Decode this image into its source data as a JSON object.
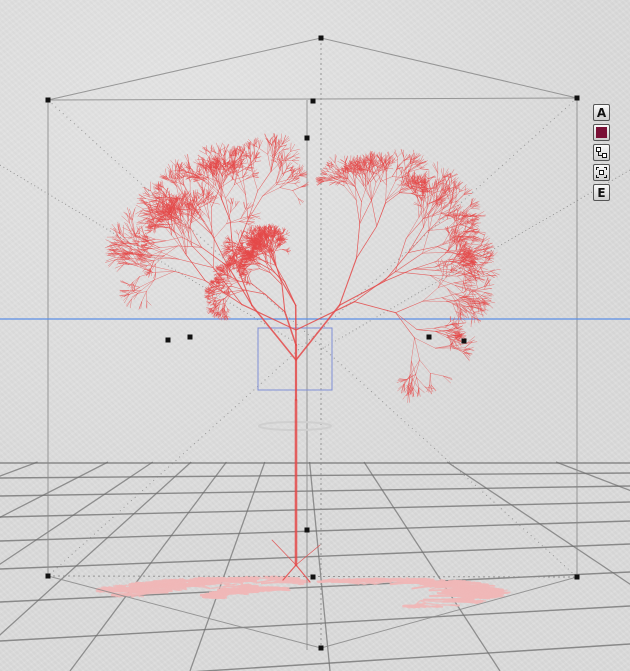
{
  "viewport": {
    "background_color": "#dcdcdc",
    "horizon_color": "#5b8fe6",
    "grid_color": "#6e6e6e",
    "bbox_color": "#8a8a8a",
    "tree_color": "#e44a4a",
    "shadow_color": "#f0b8b8",
    "handle_color": "#111111",
    "selection_box_color": "#7f8fd6"
  },
  "toolbar": {
    "buttons": [
      {
        "name": "a-button",
        "label": "A"
      },
      {
        "name": "color-swatch-button",
        "label": "",
        "color": "#7a1036"
      },
      {
        "name": "hierarchy-icon",
        "label": ""
      },
      {
        "name": "frame-selection-icon",
        "label": ""
      },
      {
        "name": "e-button",
        "label": "E"
      }
    ]
  }
}
